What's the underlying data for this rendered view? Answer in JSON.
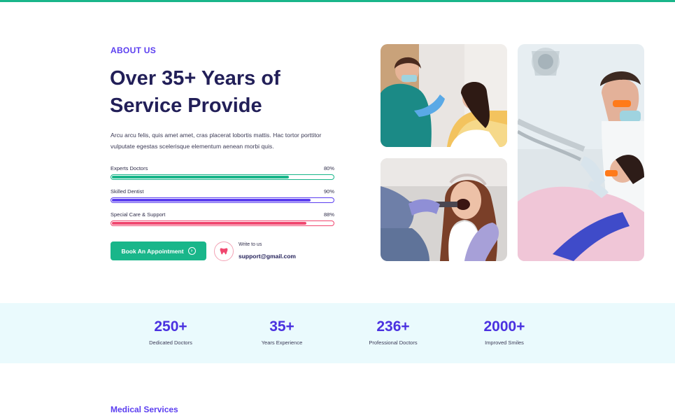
{
  "theme": {
    "accent_green": "#19b68a",
    "accent_purple": "#5b3ef0",
    "accent_pink": "#f0476f",
    "heading_navy": "#221f58",
    "stats_background": "#eafafd"
  },
  "about": {
    "eyebrow": "ABOUT US",
    "headline_line1": "Over 35+ Years of",
    "headline_line2": "Service Provide",
    "description": "Arcu arcu felis, quis amet amet, cras placerat lobortis mattis. Hac tortor porttitor vulputate egestas scelerisque elementum aenean morbi quis."
  },
  "skills": [
    {
      "label": "Experts Doctors",
      "percent_text": "80%",
      "percent": 80,
      "color": "#19b68a"
    },
    {
      "label": "Skilled Dentist",
      "percent_text": "90%",
      "percent": 90,
      "color": "#5b3ef0"
    },
    {
      "label": "Special Care & Support",
      "percent_text": "88%",
      "percent": 88,
      "color": "#f0476f"
    }
  ],
  "cta": {
    "button_label": "Book An Appointment",
    "button_icon": "arrow-right-circle-icon",
    "contact_icon": "tooth-icon",
    "contact_label": "Write to us",
    "contact_email": "support@gmail.com"
  },
  "gallery": {
    "images": [
      {
        "name": "dentist-examining-patient-photo"
      },
      {
        "name": "patient-open-mouth-photo"
      },
      {
        "name": "dentist-treatment-photo"
      }
    ]
  },
  "stats": [
    {
      "number": "250+",
      "label": "Dedicated Doctors"
    },
    {
      "number": "35+",
      "label": "Years Experience"
    },
    {
      "number": "236+",
      "label": "Professional Doctors"
    },
    {
      "number": "2000+",
      "label": "Improved Smiles"
    }
  ],
  "services": {
    "title": "Medical Services"
  }
}
